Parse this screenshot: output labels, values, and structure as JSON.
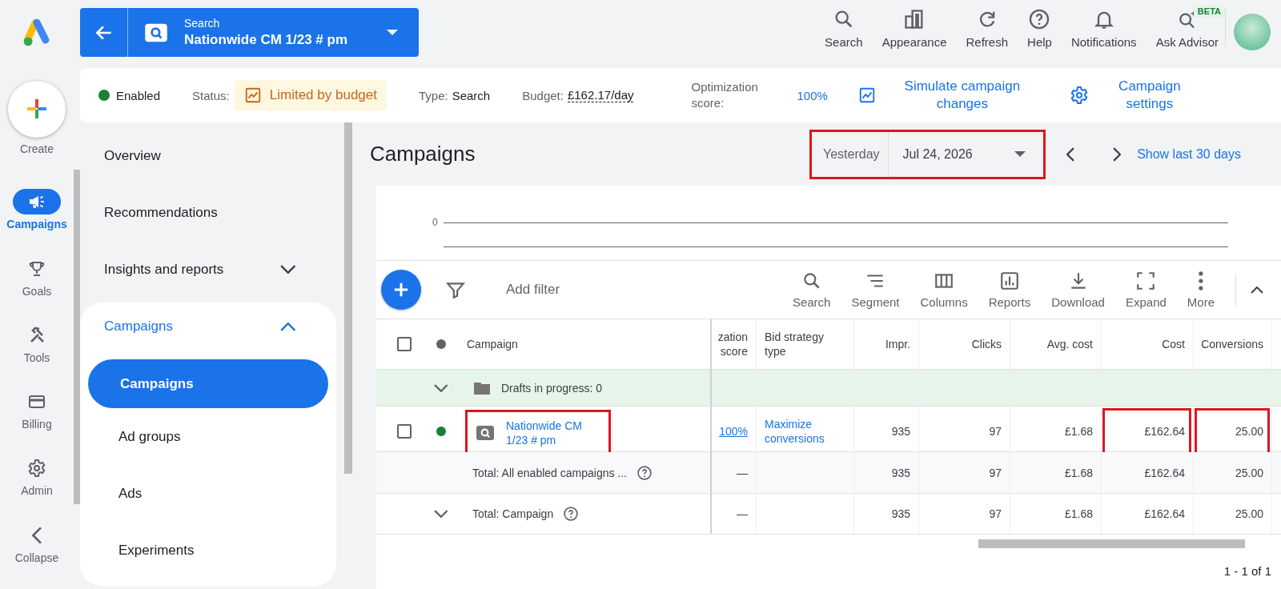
{
  "rail": {
    "create_label": "Create",
    "items": [
      {
        "label": "Campaigns",
        "selected": true
      },
      {
        "label": "Goals",
        "selected": false
      },
      {
        "label": "Tools",
        "selected": false
      },
      {
        "label": "Billing",
        "selected": false
      },
      {
        "label": "Admin",
        "selected": false
      }
    ],
    "collapse_label": "Collapse"
  },
  "campaign_selector": {
    "type": "Search",
    "name": "Nationwide CM 1/23 # pm"
  },
  "header_actions": [
    {
      "label": "Search"
    },
    {
      "label": "Appearance"
    },
    {
      "label": "Refresh"
    },
    {
      "label": "Help"
    },
    {
      "label": "Notifications"
    },
    {
      "label": "Ask Advisor",
      "badge": "BETA"
    }
  ],
  "summary": {
    "status": "Enabled",
    "status_label": "Status:",
    "status_value": "Limited by budget",
    "type_label": "Type:",
    "type_value": "Search",
    "budget_label": "Budget:",
    "budget_value": "£162.17/day",
    "optimization_label": "Optimization score:",
    "optimization_value": "100%",
    "simulate_label": "Simulate campaign changes",
    "settings_label": "Campaign settings"
  },
  "nav": {
    "items": [
      {
        "label": "Overview",
        "selected": false
      },
      {
        "label": "Recommendations",
        "selected": false
      },
      {
        "label": "Insights and reports",
        "selected": false,
        "expanded": false
      },
      {
        "label": "Campaigns",
        "selected": true,
        "expanded": true,
        "children": [
          {
            "label": "Campaigns",
            "selected": true
          },
          {
            "label": "Ad groups",
            "selected": false
          },
          {
            "label": "Ads",
            "selected": false
          },
          {
            "label": "Experiments",
            "selected": false
          }
        ]
      }
    ]
  },
  "main": {
    "title": "Campaigns",
    "date_range": {
      "preset": "Yesterday",
      "date": "Jul 24, 2026",
      "highlighted": true
    },
    "show_last": "Show last 30 days"
  },
  "chart": {
    "axis_label": "0"
  },
  "table_toolbar": {
    "filter_placeholder": "Add filter",
    "actions": [
      {
        "label": "Search"
      },
      {
        "label": "Segment"
      },
      {
        "label": "Columns"
      },
      {
        "label": "Reports"
      },
      {
        "label": "Download"
      },
      {
        "label": "Expand"
      },
      {
        "label": "More"
      }
    ]
  },
  "table": {
    "header_checked": false,
    "columns": [
      "Campaign",
      "zation score",
      "Bid strategy type",
      "Impr.",
      "Clicks",
      "Avg. cost",
      "Cost",
      "Conversions"
    ],
    "rows": [
      {
        "kind": "drafts",
        "expanded": false,
        "label": "Drafts in progress: 0"
      },
      {
        "kind": "campaign",
        "checked": false,
        "name": "Nationwide CM 1/23 # pm",
        "highlighted": true,
        "cells": [
          {
            "text": "100%",
            "highlighted": false
          },
          {
            "text": "Maximize conversions",
            "highlighted": false
          },
          {
            "text": "935",
            "highlighted": false
          },
          {
            "text": "97",
            "highlighted": false
          },
          {
            "text": "£1.68",
            "highlighted": false
          },
          {
            "text": "£162.64",
            "highlighted": true
          },
          {
            "text": "25.00",
            "highlighted": true
          }
        ]
      },
      {
        "kind": "total",
        "label": "Total: All enabled campaigns ...",
        "cells": [
          {
            "text": "—",
            "highlighted": false
          },
          null,
          {
            "text": "935",
            "highlighted": false
          },
          {
            "text": "97",
            "highlighted": false
          },
          {
            "text": "£1.68",
            "highlighted": false
          },
          {
            "text": "£162.64",
            "highlighted": false
          },
          {
            "text": "25.00",
            "highlighted": false
          }
        ]
      },
      {
        "kind": "total",
        "expanded": false,
        "label": "Total: Campaign",
        "cells": [
          {
            "text": "—",
            "highlighted": false
          },
          null,
          {
            "text": "935",
            "highlighted": false
          },
          {
            "text": "97",
            "highlighted": false
          },
          {
            "text": "£1.68",
            "highlighted": false
          },
          {
            "text": "£162.64",
            "highlighted": false
          },
          {
            "text": "25.00",
            "highlighted": false
          }
        ]
      }
    ]
  },
  "pagination": "1 - 1 of 1"
}
